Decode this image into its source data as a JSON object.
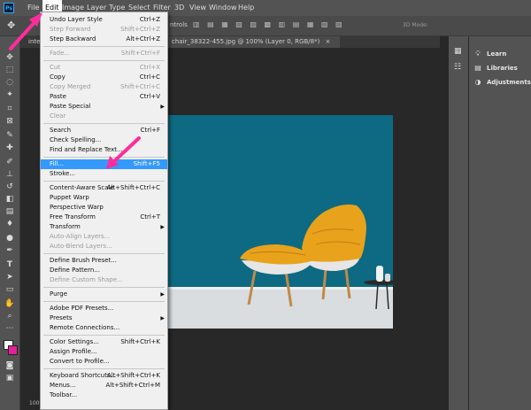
{
  "menubar": {
    "items": [
      {
        "label": "File"
      },
      {
        "label": "Edit"
      },
      {
        "label": "Image"
      },
      {
        "label": "Layer"
      },
      {
        "label": "Type"
      },
      {
        "label": "Select"
      },
      {
        "label": "Filter"
      },
      {
        "label": "3D"
      },
      {
        "label": "View"
      },
      {
        "label": "Window"
      },
      {
        "label": "Help"
      }
    ],
    "active": "Edit"
  },
  "app_logo": "Ps",
  "options_bar": {
    "controls_label": "ntrols",
    "mode_label": "3D Mode:"
  },
  "document": {
    "tab_left_fragment": "inte",
    "tab_title": "chair_38322-455.jpg @ 100% (Layer 0, RGB/8*)",
    "zoom": "100%"
  },
  "panels": [
    {
      "label": "Learn",
      "icon": "lightbulb-icon"
    },
    {
      "label": "Libraries",
      "icon": "libraries-icon"
    },
    {
      "label": "Adjustments",
      "icon": "adjustments-icon"
    }
  ],
  "edit_menu": {
    "items": [
      {
        "label": "Undo Layer Style",
        "shortcut": "Ctrl+Z",
        "enabled": true
      },
      {
        "label": "Step Forward",
        "shortcut": "Shift+Ctrl+Z",
        "enabled": false
      },
      {
        "label": "Step Backward",
        "shortcut": "Alt+Ctrl+Z",
        "enabled": true
      },
      {
        "sep": true
      },
      {
        "label": "Fade...",
        "shortcut": "Shift+Ctrl+F",
        "enabled": false
      },
      {
        "sep": true
      },
      {
        "label": "Cut",
        "shortcut": "Ctrl+X",
        "enabled": false
      },
      {
        "label": "Copy",
        "shortcut": "Ctrl+C",
        "enabled": true
      },
      {
        "label": "Copy Merged",
        "shortcut": "Shift+Ctrl+C",
        "enabled": false
      },
      {
        "label": "Paste",
        "shortcut": "Ctrl+V",
        "enabled": true
      },
      {
        "label": "Paste Special",
        "shortcut": "",
        "enabled": true,
        "submenu": true
      },
      {
        "label": "Clear",
        "shortcut": "",
        "enabled": false
      },
      {
        "sep": true
      },
      {
        "label": "Search",
        "shortcut": "Ctrl+F",
        "enabled": true
      },
      {
        "label": "Check Spelling...",
        "shortcut": "",
        "enabled": true
      },
      {
        "label": "Find and Replace Text...",
        "shortcut": "",
        "enabled": true
      },
      {
        "sep": true
      },
      {
        "label": "Fill...",
        "shortcut": "Shift+F5",
        "enabled": true,
        "highlighted": true
      },
      {
        "label": "Stroke...",
        "shortcut": "",
        "enabled": true
      },
      {
        "sep": true
      },
      {
        "label": "Content-Aware Scale",
        "shortcut": "Alt+Shift+Ctrl+C",
        "enabled": true
      },
      {
        "label": "Puppet Warp",
        "shortcut": "",
        "enabled": true
      },
      {
        "label": "Perspective Warp",
        "shortcut": "",
        "enabled": true
      },
      {
        "label": "Free Transform",
        "shortcut": "Ctrl+T",
        "enabled": true
      },
      {
        "label": "Transform",
        "shortcut": "",
        "enabled": true,
        "submenu": true
      },
      {
        "label": "Auto-Align Layers...",
        "shortcut": "",
        "enabled": false
      },
      {
        "label": "Auto-Blend Layers...",
        "shortcut": "",
        "enabled": false
      },
      {
        "sep": true
      },
      {
        "label": "Define Brush Preset...",
        "shortcut": "",
        "enabled": true
      },
      {
        "label": "Define Pattern...",
        "shortcut": "",
        "enabled": true
      },
      {
        "label": "Define Custom Shape...",
        "shortcut": "",
        "enabled": false
      },
      {
        "sep": true
      },
      {
        "label": "Purge",
        "shortcut": "",
        "enabled": true,
        "submenu": true
      },
      {
        "sep": true
      },
      {
        "label": "Adobe PDF Presets...",
        "shortcut": "",
        "enabled": true
      },
      {
        "label": "Presets",
        "shortcut": "",
        "enabled": true,
        "submenu": true
      },
      {
        "label": "Remote Connections...",
        "shortcut": "",
        "enabled": true
      },
      {
        "sep": true
      },
      {
        "label": "Color Settings...",
        "shortcut": "Shift+Ctrl+K",
        "enabled": true
      },
      {
        "label": "Assign Profile...",
        "shortcut": "",
        "enabled": true
      },
      {
        "label": "Convert to Profile...",
        "shortcut": "",
        "enabled": true
      },
      {
        "sep": true
      },
      {
        "label": "Keyboard Shortcuts...",
        "shortcut": "Alt+Shift+Ctrl+K",
        "enabled": true
      },
      {
        "label": "Menus...",
        "shortcut": "Alt+Shift+Ctrl+M",
        "enabled": true
      },
      {
        "label": "Toolbar...",
        "shortcut": "",
        "enabled": true
      }
    ]
  },
  "colors": {
    "accent_highlight": "#3399ff",
    "annotation_arrow": "#ff2d9b",
    "canvas_wall": "#0e6a82",
    "canvas_floor": "#d9dde0",
    "chair_fabric": "#e8a21c"
  }
}
